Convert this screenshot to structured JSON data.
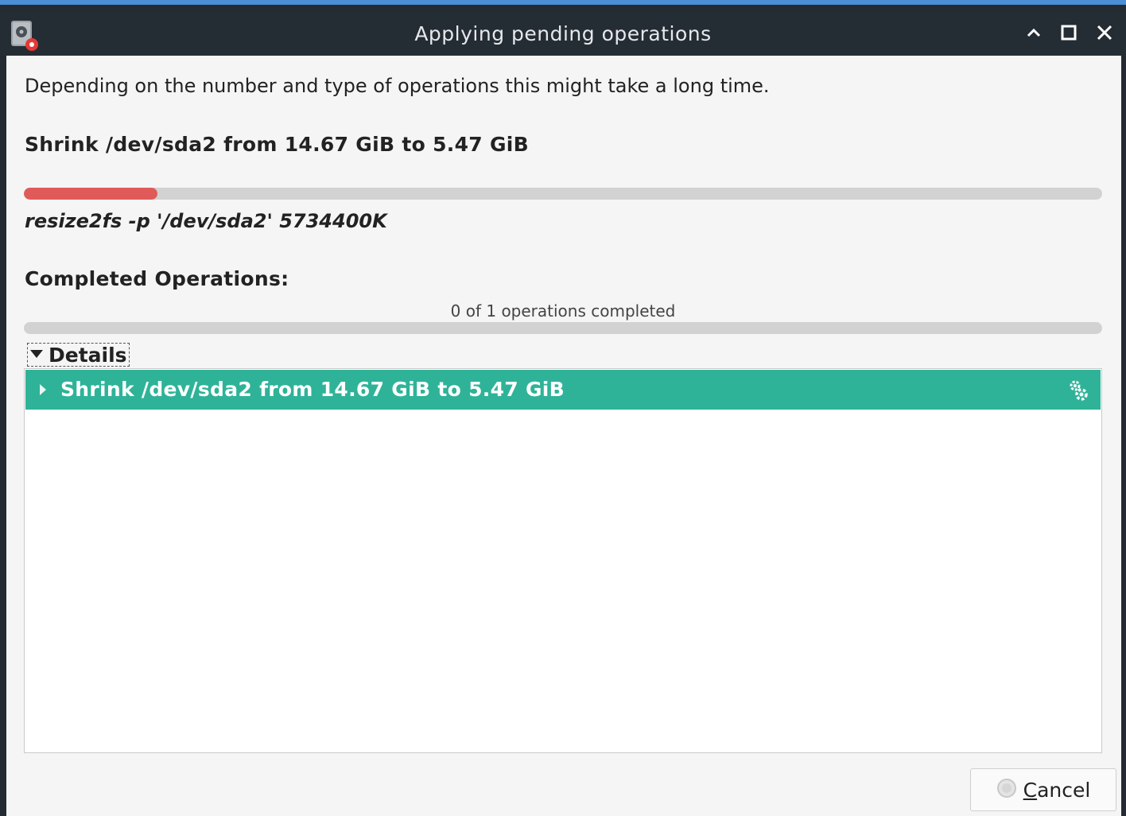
{
  "window": {
    "title": "Applying pending operations"
  },
  "icons": {
    "app": "gparted-icon",
    "minimize": "chevron-up-icon",
    "maximize": "maximize-icon",
    "close": "close-icon",
    "details_toggle": "triangle-down-icon",
    "row_expander": "triangle-right-icon",
    "row_status": "gears-icon",
    "cancel": "cancel-icon"
  },
  "colors": {
    "accent_row": "#2eb398",
    "progress_fill": "#e05a5a",
    "title_bar": "#252d34",
    "window_border": "#4b8fd6"
  },
  "intro": "Depending on the number and type of operations this might take a long time.",
  "current_operation": {
    "title": "Shrink /dev/sda2 from 14.67 GiB to 5.47 GiB",
    "progress_fraction": 0.124,
    "command": "resize2fs -p '/dev/sda2' 5734400K"
  },
  "completed": {
    "label": "Completed Operations:",
    "status_text": "0 of 1 operations completed",
    "progress_fraction": 0
  },
  "details": {
    "label": "Details",
    "expanded": true,
    "rows": [
      {
        "label": "Shrink /dev/sda2 from 14.67 GiB to 5.47 GiB"
      }
    ]
  },
  "buttons": {
    "cancel_mnemonic": "C",
    "cancel_rest": "ancel"
  }
}
